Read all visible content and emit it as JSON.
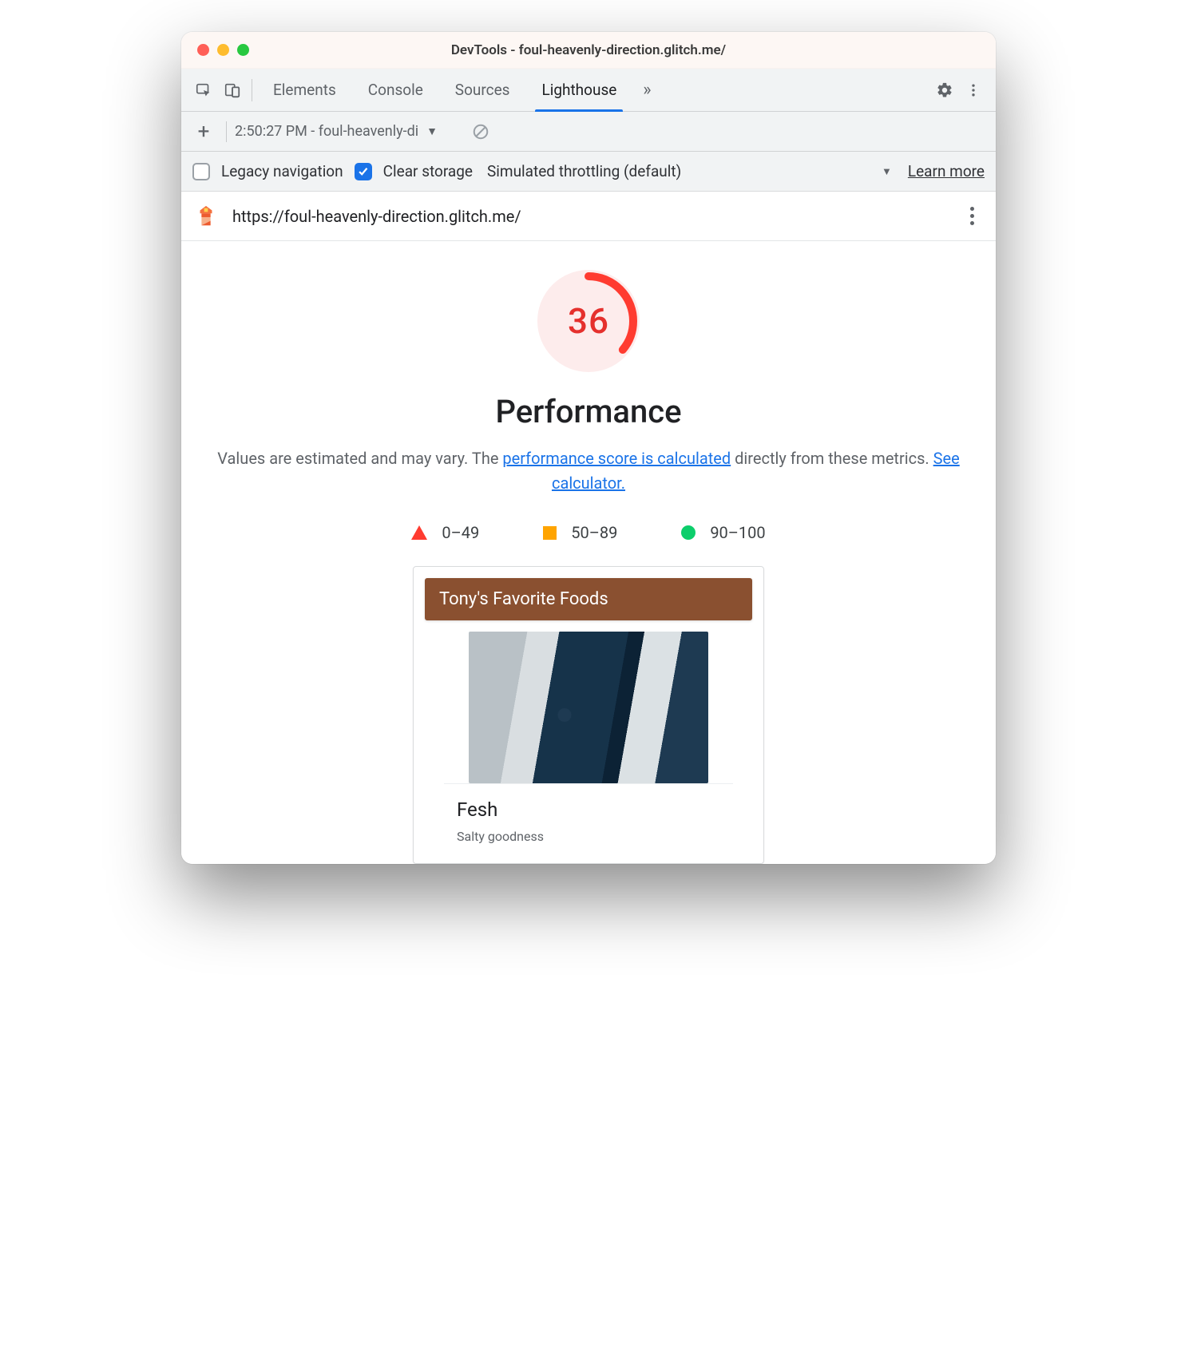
{
  "window": {
    "title": "DevTools - foul-heavenly-direction.glitch.me/"
  },
  "tabs": {
    "elements": "Elements",
    "console": "Console",
    "sources": "Sources",
    "lighthouse": "Lighthouse"
  },
  "toolbar2": {
    "report_label": "2:50:27 PM - foul-heavenly-di"
  },
  "toolbar3": {
    "legacy_label": "Legacy navigation",
    "legacy_checked": false,
    "clear_label": "Clear storage",
    "clear_checked": true,
    "throttling_label": "Simulated throttling (default)",
    "learn_more": "Learn more"
  },
  "urlbar": {
    "url": "https://foul-heavenly-direction.glitch.me/"
  },
  "report": {
    "score": "36",
    "heading": "Performance",
    "desc_pre": "Values are estimated and may vary. The ",
    "desc_link1": "performance score is calculated",
    "desc_mid": " directly from these metrics. ",
    "desc_link2": "See calculator.",
    "legend": {
      "low": "0–49",
      "mid": "50–89",
      "high": "90–100"
    }
  },
  "preview": {
    "header": "Tony's Favorite Foods",
    "card_title": "Fesh",
    "card_sub": "Salty goodness"
  },
  "colors": {
    "fail": "#ff3b30",
    "avg": "#ffa400",
    "pass": "#0cce6b",
    "link": "#1a73e8"
  }
}
